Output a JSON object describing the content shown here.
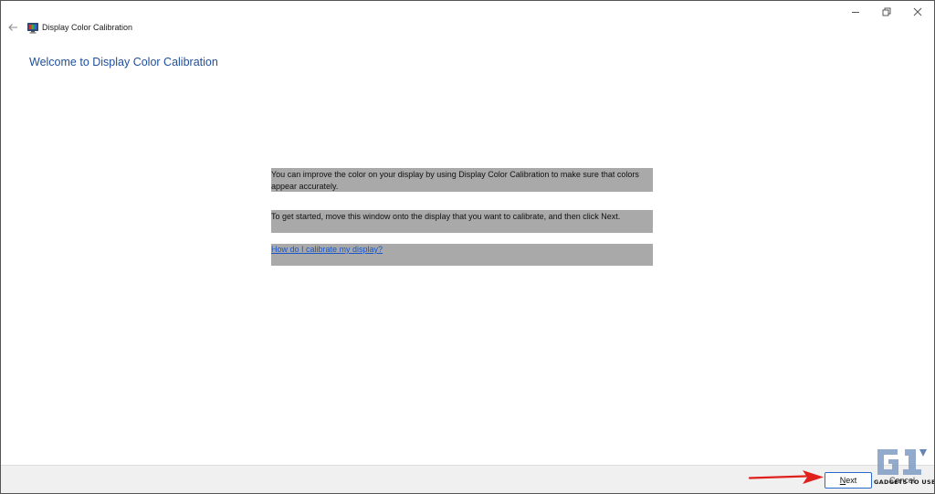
{
  "window": {
    "title": "Display Color Calibration"
  },
  "page": {
    "heading": "Welcome to Display Color Calibration",
    "paragraph1": "You can improve the color on your display by using Display Color Calibration to make sure that colors appear accurately.",
    "paragraph2": "To get started, move this window onto the display that you want to calibrate, and then click Next.",
    "help_link": "How do I calibrate my display?"
  },
  "footer": {
    "next_label": "Next",
    "next_accesskey": "N",
    "next_rest": "ext",
    "cancel_label": "Cancel"
  },
  "watermark": {
    "text": "GADGETS TO USE"
  },
  "colors": {
    "heading": "#1f4e9a",
    "highlight": "#a9a9a9",
    "link": "#1a56c4",
    "arrow": "#e0201c"
  },
  "icons": {
    "back": "back-arrow-icon",
    "app": "display-calibration-icon",
    "minimize": "minimize-icon",
    "maximize": "restore-icon",
    "close": "close-icon"
  }
}
